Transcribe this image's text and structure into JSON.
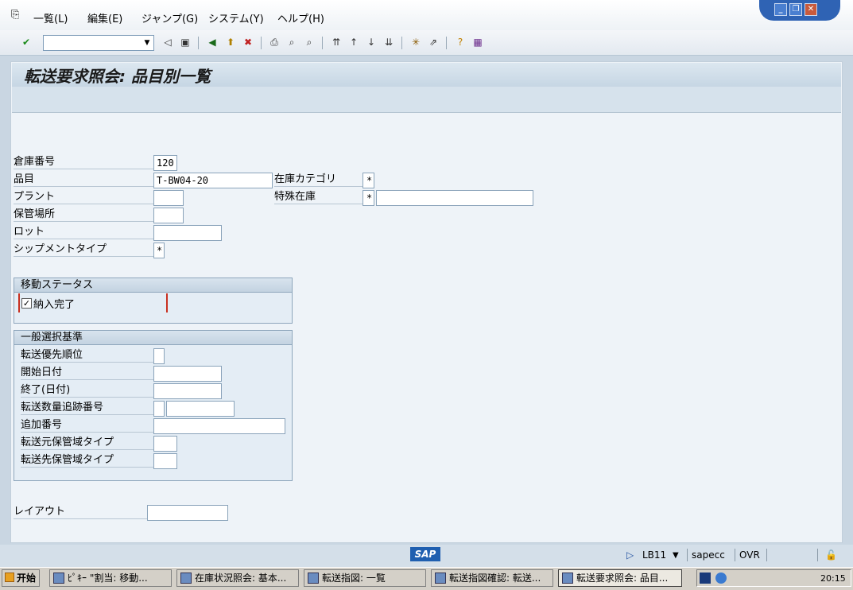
{
  "menu": [
    "一覧(L)",
    "編集(E)",
    "ジャンプ(G)",
    "システム(Y)",
    "ヘルプ(H)"
  ],
  "toolbar": {
    "command_value": ""
  },
  "page": {
    "title": "転送要求照会: 品目別一覧"
  },
  "fields": {
    "warehouse": {
      "label": "倉庫番号",
      "value": "120"
    },
    "material": {
      "label": "品目",
      "value": "T-BW04-20"
    },
    "stock_category": {
      "label": "在庫カテゴリ",
      "value": "*"
    },
    "plant": {
      "label": "プラント",
      "value": ""
    },
    "special_stock": {
      "label": "特殊在庫",
      "value": "*",
      "value2": ""
    },
    "storage_location": {
      "label": "保管場所",
      "value": ""
    },
    "lot": {
      "label": "ロット",
      "value": ""
    },
    "shipment_type": {
      "label": "シップメントタイプ",
      "value": "*"
    },
    "layout": {
      "label": "レイアウト",
      "value": ""
    }
  },
  "movement_status": {
    "title": "移動ステータス",
    "checkbox_label": "納入完了",
    "checked": true,
    "check_glyph": "✓"
  },
  "general": {
    "title": "一般選択基準",
    "rows": [
      {
        "label": "転送優先順位",
        "value": ""
      },
      {
        "label": "開始日付",
        "value": ""
      },
      {
        "label": "終了(日付)",
        "value": ""
      },
      {
        "label": "転送数量追跡番号",
        "value": "",
        "value2": ""
      },
      {
        "label": "追加番号",
        "value": ""
      },
      {
        "label": "転送元保管域タイプ",
        "value": ""
      },
      {
        "label": "転送先保管域タイプ",
        "value": ""
      }
    ]
  },
  "statusbar": {
    "logo": "SAP",
    "system": "LB11",
    "server": "sapecc",
    "mode": "OVR"
  },
  "taskbar": {
    "start": "开始",
    "tasks": [
      "ﾋﾟｷｰ \"割当: 移動...",
      "在庫状況照会: 基本...",
      "転送指図: 一覧",
      "転送指図確認: 転送...",
      "転送要求照会: 品目..."
    ],
    "clock": "20:15"
  },
  "colors": {
    "title_blue": "#2f63b4",
    "frame": "#c9d6e2"
  }
}
